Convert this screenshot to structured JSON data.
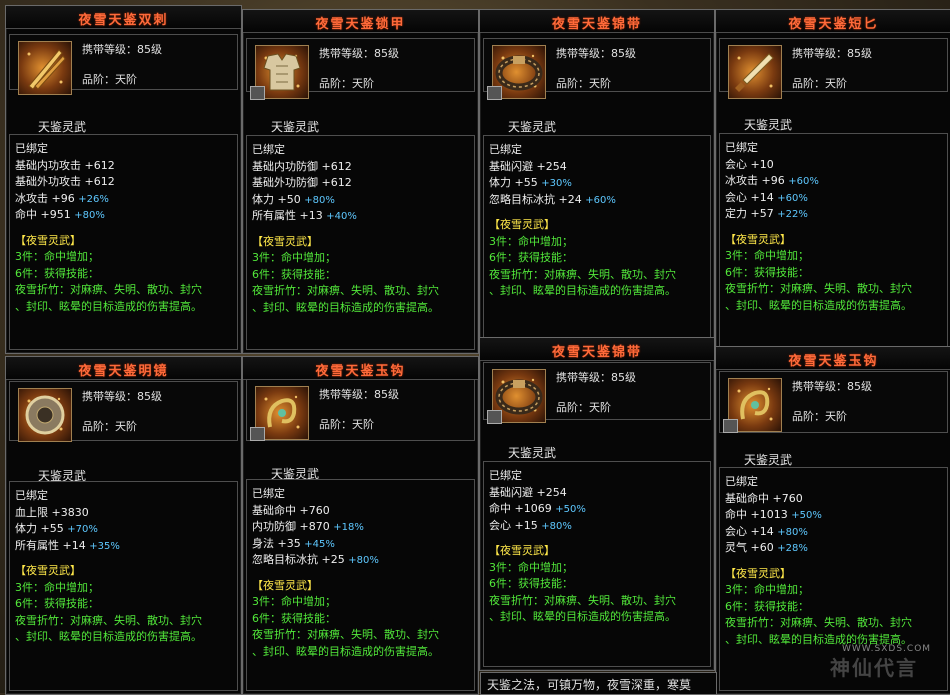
{
  "labels": {
    "carry_level": "携带等级：85级",
    "quality": "品阶：天阶",
    "tier_tag": "天鉴灵武",
    "bound": "已绑定"
  },
  "set_block": {
    "header": "【夜雪灵武】",
    "piece3": "3件：命中增加；",
    "piece6": "6件：获得技能：",
    "skill_1": "夜雪折竹：对麻痹、失明、散功、封穴",
    "skill_2": "、封印、眩晕的目标造成的伤害提高。"
  },
  "items": [
    {
      "title": "夜雪天鉴双刺",
      "icon": "twin-blade-icon",
      "stats": [
        {
          "name": "基础内功攻击",
          "value": "+612",
          "bonus": ""
        },
        {
          "name": "基础外功攻击",
          "value": "+612",
          "bonus": ""
        },
        {
          "name": "冰攻击",
          "value": "+96",
          "bonus": "+26%"
        },
        {
          "name": "命中",
          "value": "+951",
          "bonus": "+80%"
        }
      ]
    },
    {
      "title": "夜雪天鉴锁甲",
      "icon": "chain-armor-icon",
      "stats": [
        {
          "name": "基础内功防御",
          "value": "+612",
          "bonus": ""
        },
        {
          "name": "基础外功防御",
          "value": "+612",
          "bonus": ""
        },
        {
          "name": "体力",
          "value": "+50",
          "bonus": "+80%"
        },
        {
          "name": "所有属性",
          "value": "+13",
          "bonus": "+40%"
        }
      ]
    },
    {
      "title": "夜雪天鉴锦带",
      "icon": "belt-icon",
      "stats": [
        {
          "name": "基础闪避",
          "value": "+254",
          "bonus": ""
        },
        {
          "name": "体力",
          "value": "+55",
          "bonus": "+30%"
        },
        {
          "name": "忽略目标冰抗",
          "value": "+24",
          "bonus": "+60%"
        }
      ]
    },
    {
      "title": "夜雪天鉴短匕",
      "icon": "dagger-icon",
      "stats": [
        {
          "name": "会心",
          "value": "+10",
          "bonus": ""
        },
        {
          "name": "冰攻击",
          "value": "+96",
          "bonus": "+60%"
        },
        {
          "name": "会心",
          "value": "+14",
          "bonus": "+60%"
        },
        {
          "name": "定力",
          "value": "+57",
          "bonus": "+22%"
        }
      ]
    },
    {
      "title": "夜雪天鉴明镜",
      "icon": "mirror-icon",
      "stats": [
        {
          "name": "血上限",
          "value": "+3830",
          "bonus": ""
        },
        {
          "name": "体力",
          "value": "+55",
          "bonus": "+70%"
        },
        {
          "name": "所有属性",
          "value": "+14",
          "bonus": "+35%"
        }
      ]
    },
    {
      "title": "夜雪天鉴玉钩",
      "icon": "jade-hook-icon",
      "stats": [
        {
          "name": "基础命中",
          "value": "+760",
          "bonus": ""
        },
        {
          "name": "内功防御",
          "value": "+870",
          "bonus": "+18%"
        },
        {
          "name": "身法",
          "value": "+35",
          "bonus": "+45%"
        },
        {
          "name": "忽略目标冰抗",
          "value": "+25",
          "bonus": "+80%"
        }
      ]
    },
    {
      "title": "夜雪天鉴锦带",
      "icon": "belt-icon",
      "stats": [
        {
          "name": "基础闪避",
          "value": "+254",
          "bonus": ""
        },
        {
          "name": "命中",
          "value": "+1069",
          "bonus": "+50%"
        },
        {
          "name": "会心",
          "value": "+15",
          "bonus": "+80%"
        }
      ]
    },
    {
      "title": "夜雪天鉴玉钩",
      "icon": "jade-hook-icon",
      "stats": [
        {
          "name": "基础命中",
          "value": "+760",
          "bonus": ""
        },
        {
          "name": "命中",
          "value": "+1013",
          "bonus": "+50%"
        },
        {
          "name": "会心",
          "value": "+14",
          "bonus": "+80%"
        },
        {
          "name": "灵气",
          "value": "+60",
          "bonus": "+28%"
        }
      ]
    }
  ],
  "footer_text": "天鉴之法，可镇万物，夜雪深重，寒莫",
  "watermark": {
    "url": "WWW.SXDS.COM",
    "logo": "神仙代言"
  }
}
